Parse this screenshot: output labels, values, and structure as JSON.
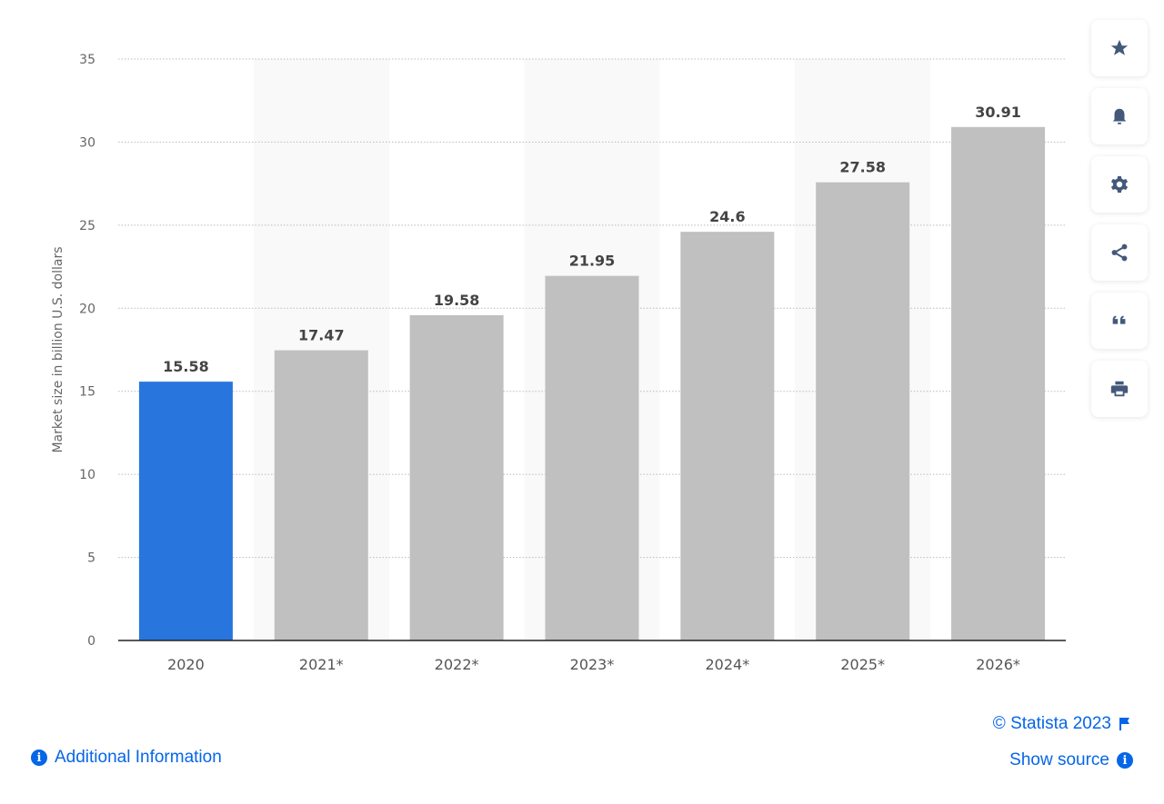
{
  "chart_data": {
    "type": "bar",
    "categories": [
      "2020",
      "2021*",
      "2022*",
      "2023*",
      "2024*",
      "2025*",
      "2026*"
    ],
    "values": [
      15.58,
      17.47,
      19.58,
      21.95,
      24.6,
      27.58,
      30.91
    ],
    "value_labels": [
      "15.58",
      "17.47",
      "19.58",
      "21.95",
      "24.6",
      "27.58",
      "30.91"
    ],
    "ylabel": "Market size in billion U.S. dollars",
    "xlabel": "",
    "ylim": [
      0,
      35
    ],
    "yticks": [
      0,
      5,
      10,
      15,
      20,
      25,
      30,
      35
    ],
    "grid": true,
    "colors": {
      "highlight": "#2876dd",
      "default": "#c0c0c0",
      "band": "#f9f9f9"
    },
    "highlighted_index": 0
  },
  "toolbar": [
    {
      "name": "star-icon"
    },
    {
      "name": "bell-icon"
    },
    {
      "name": "gear-icon"
    },
    {
      "name": "share-icon"
    },
    {
      "name": "quote-icon"
    },
    {
      "name": "print-icon"
    }
  ],
  "footer": {
    "copyright": "© Statista 2023",
    "additional_info": "Additional Information",
    "show_source": "Show source"
  }
}
